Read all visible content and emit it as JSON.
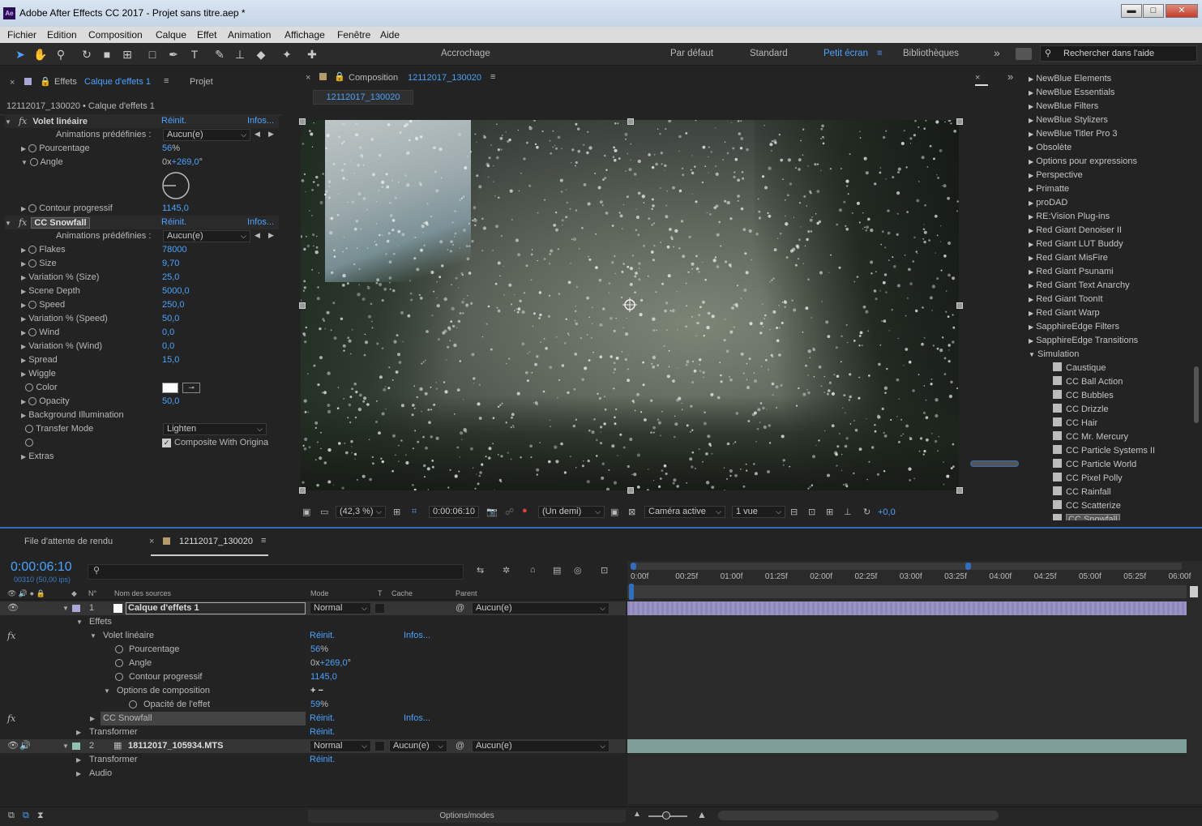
{
  "window": {
    "app_icon": "Ae",
    "title": "Adobe After Effects CC 2017 - Projet sans titre.aep *",
    "min": "▬",
    "max": "□",
    "close": "✕"
  },
  "menu": [
    "Fichier",
    "Edition",
    "Composition",
    "Calque",
    "Effet",
    "Animation",
    "Affichage",
    "Fenêtre",
    "Aide"
  ],
  "toolbar": {
    "snap_label": "Accrochage",
    "workspaces": [
      "Par défaut",
      "Standard",
      "Petit écran",
      "Bibliothèques"
    ],
    "active_workspace": "Petit écran",
    "more": "»",
    "search_placeholder": "Rechercher dans l'aide"
  },
  "effects_panel": {
    "tab_label": "Effets",
    "tab_layer": "Calque d'effets 1",
    "tab2": "Projet",
    "breadcrumb": "12112017_130020 • Calque d'effets 1",
    "reset": "Réinit.",
    "about": "Infos...",
    "preset_label": "Animations prédéfinies :",
    "preset_value": "Aucun(e)",
    "effect1": {
      "name": "Volet linéaire",
      "props": [
        {
          "name": "Pourcentage",
          "value": "56",
          "unit": "%"
        },
        {
          "name": "Angle",
          "value_pre": "0x",
          "value": "+269,0",
          "unit": "°"
        },
        {
          "name": "Contour progressif",
          "value": "1145,0",
          "unit": ""
        }
      ]
    },
    "effect2": {
      "name": "CC Snowfall",
      "props": [
        {
          "name": "Flakes",
          "value": "78000",
          "sw": true
        },
        {
          "name": "Size",
          "value": "9,70",
          "sw": true
        },
        {
          "name": "Variation % (Size)",
          "value": "25,0",
          "sw": false
        },
        {
          "name": "Scene Depth",
          "value": "5000,0",
          "sw": false
        },
        {
          "name": "Speed",
          "value": "250,0",
          "sw": true
        },
        {
          "name": "Variation % (Speed)",
          "value": "50,0",
          "sw": false
        },
        {
          "name": "Wind",
          "value": "0,0",
          "sw": true
        },
        {
          "name": "Variation % (Wind)",
          "value": "0,0",
          "sw": false
        },
        {
          "name": "Spread",
          "value": "15,0",
          "sw": false
        },
        {
          "name": "Wiggle",
          "value": "",
          "sw": false
        }
      ],
      "color_label": "Color",
      "opacity_label": "Opacity",
      "opacity_value": "50,0",
      "bg_illum": "Background Illumination",
      "transfer_label": "Transfer Mode",
      "transfer_value": "Lighten",
      "composite_label": "Composite With Origina",
      "extras": "Extras"
    }
  },
  "viewer": {
    "tab_label": "Composition",
    "comp_name": "12112017_130020",
    "breadcrumb": "12112017_130020",
    "zoom": "(42,3 %)",
    "timecode": "0:00:06:10",
    "resolution": "(Un demi)",
    "camera": "Caméra active",
    "views": "1 vue",
    "exposure": "+0,0"
  },
  "fx_list": {
    "items": [
      {
        "label": "NewBlue Elements",
        "type": "folder"
      },
      {
        "label": "NewBlue Essentials",
        "type": "folder"
      },
      {
        "label": "NewBlue Filters",
        "type": "folder"
      },
      {
        "label": "NewBlue Stylizers",
        "type": "folder"
      },
      {
        "label": "NewBlue Titler Pro 3",
        "type": "folder"
      },
      {
        "label": "Obsolète",
        "type": "folder"
      },
      {
        "label": "Options pour expressions",
        "type": "folder"
      },
      {
        "label": "Perspective",
        "type": "folder"
      },
      {
        "label": "Primatte",
        "type": "folder"
      },
      {
        "label": "proDAD",
        "type": "folder"
      },
      {
        "label": "RE:Vision Plug-ins",
        "type": "folder"
      },
      {
        "label": "Red Giant Denoiser II",
        "type": "folder"
      },
      {
        "label": "Red Giant LUT Buddy",
        "type": "folder"
      },
      {
        "label": "Red Giant MisFire",
        "type": "folder"
      },
      {
        "label": "Red Giant Psunami",
        "type": "folder"
      },
      {
        "label": "Red Giant Text Anarchy",
        "type": "folder"
      },
      {
        "label": "Red Giant ToonIt",
        "type": "folder"
      },
      {
        "label": "Red Giant Warp",
        "type": "folder"
      },
      {
        "label": "SapphireEdge Filters",
        "type": "folder"
      },
      {
        "label": "SapphireEdge Transitions",
        "type": "folder"
      },
      {
        "label": "Simulation",
        "type": "open"
      },
      {
        "label": "Caustique",
        "type": "fx"
      },
      {
        "label": "CC Ball Action",
        "type": "fx"
      },
      {
        "label": "CC Bubbles",
        "type": "fx"
      },
      {
        "label": "CC Drizzle",
        "type": "fx"
      },
      {
        "label": "CC Hair",
        "type": "fx"
      },
      {
        "label": "CC Mr. Mercury",
        "type": "fx"
      },
      {
        "label": "CC Particle Systems II",
        "type": "fx"
      },
      {
        "label": "CC Particle World",
        "type": "fx"
      },
      {
        "label": "CC Pixel Polly",
        "type": "fx"
      },
      {
        "label": "CC Rainfall",
        "type": "fx"
      },
      {
        "label": "CC Scatterize",
        "type": "fx"
      },
      {
        "label": "CC Snowfall",
        "type": "fx-sel"
      }
    ]
  },
  "timeline": {
    "tab_render": "File d'attente de rendu",
    "tab_comp": "12112017_130020",
    "timecode": "0:00:06:10",
    "frames": "00310 (50,00 ips)",
    "col_num": "N°",
    "col_source": "Nom des sources",
    "col_mode": "Mode",
    "col_t": "T",
    "col_cache": "Cache",
    "col_parent": "Parent",
    "layer1": {
      "num": "1",
      "name": "Calque d'effets 1",
      "mode": "Normal",
      "parent": "Aucun(e)"
    },
    "effects": "Effets",
    "volet": "Volet linéaire",
    "reset": "Réinit.",
    "about": "Infos...",
    "props": [
      {
        "name": "Pourcentage",
        "value": "56",
        "unit": "%"
      },
      {
        "name": "Angle",
        "value_pre": "0x",
        "value": "+269,0",
        "unit": "°"
      },
      {
        "name": "Contour progressif",
        "value": "1145,0",
        "unit": ""
      }
    ],
    "comp_options": "Options de composition",
    "comp_options_value": "+ −",
    "opacity_fx": "Opacité de l'effet",
    "opacity_fx_value": "59",
    "opacity_fx_unit": "%",
    "snowfall": "CC Snowfall",
    "transform": "Transformer",
    "layer2": {
      "num": "2",
      "name": "18112017_105934.MTS",
      "mode": "Normal",
      "track": "Aucun(e)",
      "parent": "Aucun(e)"
    },
    "audio": "Audio",
    "options_modes": "Options/modes",
    "ruler": [
      "0:00f",
      "00:25f",
      "01:00f",
      "01:25f",
      "02:00f",
      "02:25f",
      "03:00f",
      "03:25f",
      "04:00f",
      "04:25f",
      "05:00f",
      "05:25f",
      "06:00f"
    ]
  }
}
